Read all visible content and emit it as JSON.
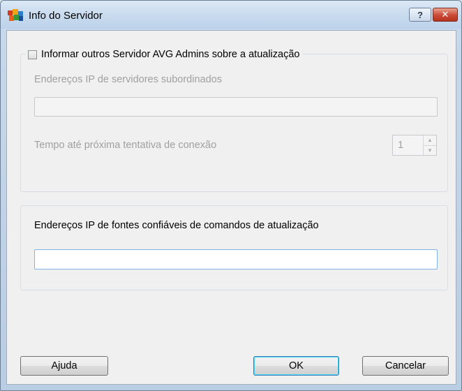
{
  "window": {
    "title": "Info do Servidor",
    "help_glyph": "?",
    "close_glyph": "✕"
  },
  "group1": {
    "checkbox_label": "Informar outros Servidor AVG Admins sobre a atualização",
    "checkbox_checked": false,
    "subordinate_ip_label": "Endereços IP de servidores subordinados",
    "subordinate_ip_value": "",
    "retry_label": "Tempo até próxima tentativa de conexão",
    "retry_value": "1"
  },
  "group2": {
    "trusted_ip_label": "Endereços IP de fontes confiáveis de comandos de atualização",
    "trusted_ip_value": ""
  },
  "buttons": {
    "help": "Ajuda",
    "ok": "OK",
    "cancel": "Cancelar"
  },
  "icons": {
    "app": "avg-logo-icon",
    "spin_up": "spin-up-icon",
    "spin_down": "spin-down-icon"
  }
}
